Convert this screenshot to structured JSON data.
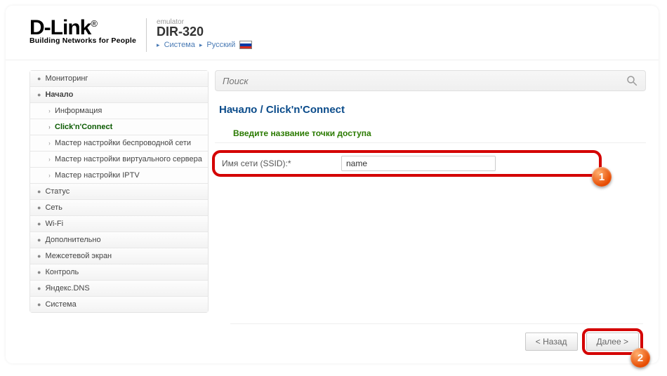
{
  "header": {
    "brand": "D-Link",
    "tagline": "Building Networks for People",
    "emulator_label": "emulator",
    "device": "DIR-320",
    "link_system": "Система",
    "link_lang": "Русский"
  },
  "sidebar": {
    "items": [
      {
        "label": "Мониторинг",
        "active": false
      },
      {
        "label": "Начало",
        "active": true
      },
      {
        "label": "Статус",
        "active": false
      },
      {
        "label": "Сеть",
        "active": false
      },
      {
        "label": "Wi-Fi",
        "active": false
      },
      {
        "label": "Дополнительно",
        "active": false
      },
      {
        "label": "Межсетевой экран",
        "active": false
      },
      {
        "label": "Контроль",
        "active": false
      },
      {
        "label": "Яндекс.DNS",
        "active": false
      },
      {
        "label": "Система",
        "active": false
      }
    ],
    "sub": [
      {
        "label": "Информация",
        "active": false
      },
      {
        "label": "Click'n'Connect",
        "active": true
      },
      {
        "label": "Мастер настройки беспроводной сети",
        "active": false
      },
      {
        "label": "Мастер настройки виртуального сервера",
        "active": false
      },
      {
        "label": "Мастер настройки IPTV",
        "active": false
      }
    ]
  },
  "search": {
    "placeholder": "Поиск"
  },
  "breadcrumb": "Начало /  Click'n'Connect",
  "section_title": "Введите название точки доступа",
  "field": {
    "label": "Имя сети (SSID):*",
    "value": "name"
  },
  "buttons": {
    "back": "< Назад",
    "next": "Далее >"
  },
  "badges": {
    "one": "1",
    "two": "2"
  }
}
